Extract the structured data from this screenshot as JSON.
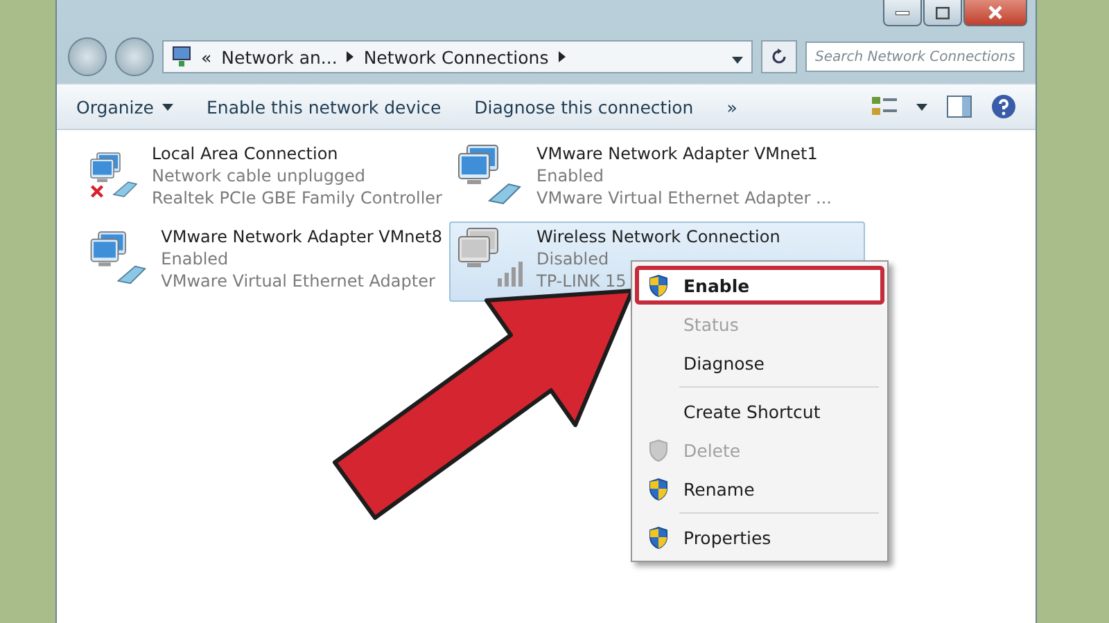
{
  "address": {
    "root_marker": "«",
    "crumbs": [
      "Network an...",
      "Network Connections"
    ],
    "search": {
      "placeholder": "Search Network Connections"
    }
  },
  "toolbar": {
    "buttons": [
      {
        "label": "Organize",
        "dropdown": true
      },
      {
        "label": "Enable this network device",
        "dropdown": false
      },
      {
        "label": "Diagnose this connection",
        "dropdown": false
      }
    ],
    "overflow": "»"
  },
  "connections": [
    {
      "name": "Local Area Connection",
      "status": "Network cable unplugged",
      "device": "Realtek PCIe GBE Family Controller",
      "error": true,
      "disabled": false,
      "selected": false
    },
    {
      "name": "VMware Network Adapter VMnet1",
      "status": "Enabled",
      "device": "VMware Virtual Ethernet Adapter ...",
      "error": false,
      "disabled": false,
      "selected": false
    },
    {
      "name": "VMware Network Adapter VMnet8",
      "status": "Enabled",
      "device": "VMware Virtual Ethernet Adapter",
      "error": false,
      "disabled": false,
      "selected": false
    },
    {
      "name": "Wireless Network Connection",
      "status": "Disabled",
      "device": "TP-LINK 15",
      "error": false,
      "disabled": true,
      "selected": true
    }
  ],
  "context_menu": [
    {
      "kind": "item",
      "label": "Enable",
      "shield": true,
      "default": true,
      "disabled": false,
      "selected": true
    },
    {
      "kind": "item",
      "label": "Status",
      "shield": false,
      "default": false,
      "disabled": true,
      "selected": false
    },
    {
      "kind": "item",
      "label": "Diagnose",
      "shield": false,
      "default": false,
      "disabled": false,
      "selected": false
    },
    {
      "kind": "separator"
    },
    {
      "kind": "item",
      "label": "Create Shortcut",
      "shield": false,
      "default": false,
      "disabled": false,
      "selected": false
    },
    {
      "kind": "item",
      "label": "Delete",
      "shield": true,
      "default": false,
      "disabled": true,
      "selected": false
    },
    {
      "kind": "item",
      "label": "Rename",
      "shield": true,
      "default": false,
      "disabled": false,
      "selected": false
    },
    {
      "kind": "separator"
    },
    {
      "kind": "item",
      "label": "Properties",
      "shield": true,
      "default": false,
      "disabled": false,
      "selected": false
    }
  ]
}
